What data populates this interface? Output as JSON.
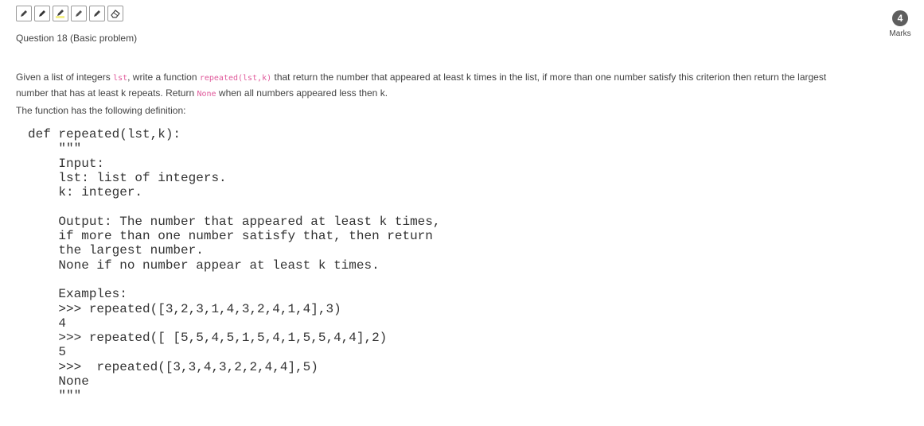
{
  "toolbar": {
    "tools": [
      {
        "name": "pencil-tool"
      },
      {
        "name": "pen-tool"
      },
      {
        "name": "highlighter-tool"
      },
      {
        "name": "marker-tool"
      },
      {
        "name": "brush-tool"
      },
      {
        "name": "eraser-tool"
      }
    ]
  },
  "question": {
    "title": "Question 18 (Basic problem)",
    "marks_value": "4",
    "marks_label": "Marks"
  },
  "description": {
    "p1": "Given a list of integers ",
    "c1": "lst",
    "p2": ", write a function ",
    "c2": "repeated(lst,k)",
    "p3": " that return the number that appeared at least k times in the list, if more than one number satisfy this criterion then return the largest number that has at least k repeats. Return ",
    "c3": "None",
    "p4": " when all numbers appeared less then k."
  },
  "definition_intro": "The function has the following definition:",
  "code_block": "def repeated(lst,k):\n    \"\"\"\n    Input:\n    lst: list of integers.\n    k: integer.\n\n    Output: The number that appeared at least k times,\n    if more than one number satisfy that, then return\n    the largest number.\n    None if no number appear at least k times.\n\n    Examples:\n    >>> repeated([3,2,3,1,4,3,2,4,1,4],3)\n    4\n    >>> repeated([ [5,5,4,5,1,5,4,1,5,5,4,4],2)\n    5\n    >>>  repeated([3,3,4,3,2,2,4,4],5)\n    None\n    \"\"\""
}
